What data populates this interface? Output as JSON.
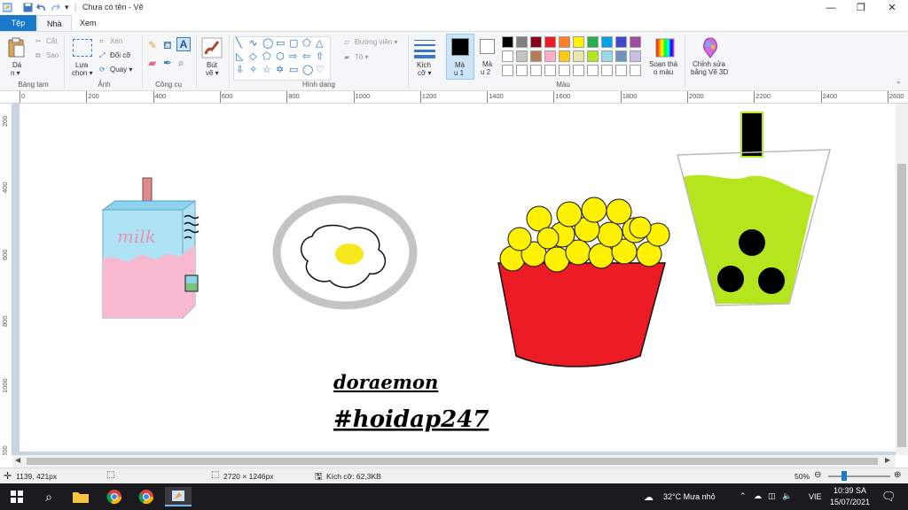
{
  "window": {
    "title": "Chưa có tên - Vẽ",
    "controls": [
      "—",
      "❐",
      "✕"
    ]
  },
  "tabs": {
    "file": "Tệp",
    "home": "Nhà",
    "view": "Xem"
  },
  "ribbon": {
    "clipboard": {
      "paste": "Dá",
      "paste_sub": "n ▾",
      "cut": "Cắt",
      "copy": "Sao",
      "group": "Bảng tạm"
    },
    "image": {
      "select": "Lựa",
      "select_sub": "chọn ▾",
      "crop": "Xén",
      "resize": "Đổi cỡ",
      "rotate": "Quay ▾",
      "group": "Ảnh"
    },
    "tools": {
      "group": "Công cụ"
    },
    "brushes": {
      "label": "Bút",
      "label_sub": "vẽ ▾"
    },
    "shapes": {
      "outline": "Đường viền ▾",
      "fill": "Tô ▾",
      "group": "Hình dạng"
    },
    "size": {
      "label": "Kích",
      "label_sub": "cỡ ▾"
    },
    "color1": {
      "label": "Mà",
      "label_sub": "u 1"
    },
    "color2": {
      "label": "Mà",
      "label_sub": "u 2"
    },
    "colors": {
      "group": "Màu",
      "row1": [
        "#000000",
        "#7f7f7f",
        "#880015",
        "#ed1c24",
        "#ff7f27",
        "#fff200",
        "#22b14c",
        "#00a2e8",
        "#3f48cc",
        "#a349a4"
      ],
      "row2": [
        "#ffffff",
        "#c3c3c3",
        "#b97a57",
        "#ffaec9",
        "#ffc90e",
        "#efe4b0",
        "#b5e61d",
        "#99d9ea",
        "#7092be",
        "#c8bfe7"
      ],
      "row3": [
        "#ffffff",
        "#ffffff",
        "#ffffff",
        "#ffffff",
        "#ffffff",
        "#ffffff",
        "#ffffff",
        "#ffffff",
        "#ffffff",
        "#ffffff"
      ]
    },
    "edit_colors": {
      "label": "Soạn thả",
      "label_sub": "o màu"
    },
    "paint3d": {
      "label": "Chỉnh sửa",
      "label_sub": "bằng Vẽ 3D"
    }
  },
  "ruler": {
    "h_ticks": [
      "0",
      "200",
      "400",
      "600",
      "800",
      "1000",
      "1200",
      "1400",
      "1600",
      "1800",
      "2000",
      "2200",
      "2400",
      "2600"
    ],
    "v_ticks": [
      "200",
      "400",
      "600",
      "800",
      "1000",
      "1200"
    ]
  },
  "canvas": {
    "milk_label": "milk",
    "text1": "doraemon",
    "text2": "#hoidap247"
  },
  "status": {
    "cursor_pos": "1139, 421px",
    "image_size": "2720 × 1246px",
    "file_size": "Kích cỡ: 62,3KB",
    "zoom": "50%"
  },
  "taskbar": {
    "weather": "32°C  Mưa nhỏ",
    "lang": "VIE",
    "time": "10:39 SA",
    "date": "15/07/2021"
  }
}
